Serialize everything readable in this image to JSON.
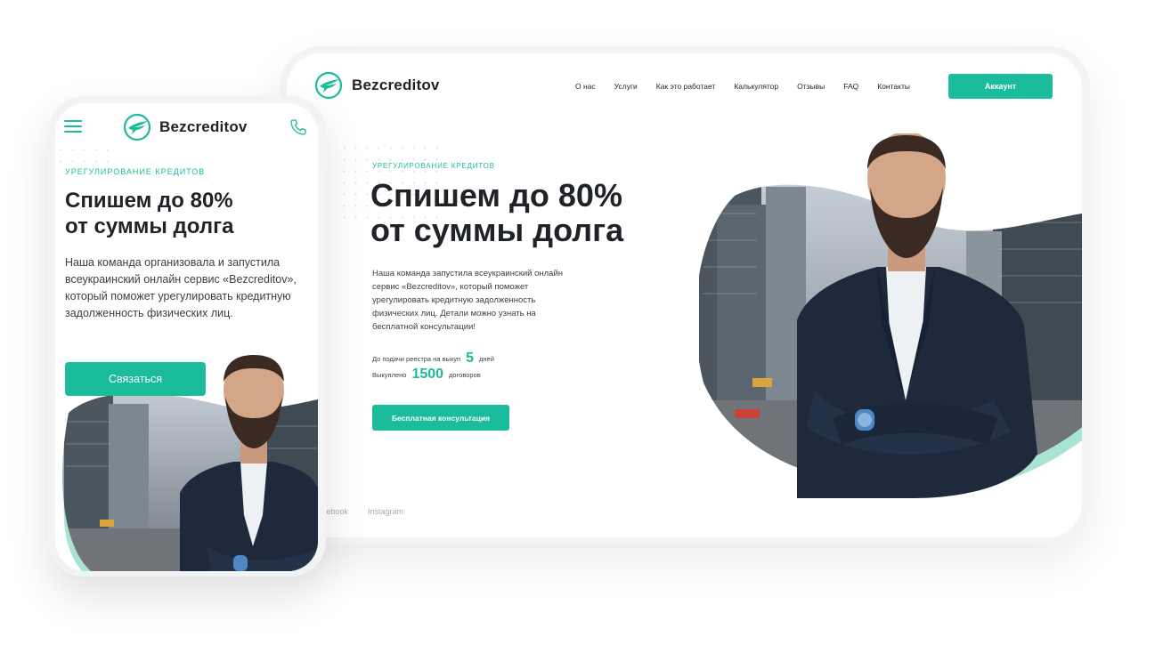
{
  "brand": {
    "name": "Bezcreditov",
    "accent_color": "#1bbc9b",
    "logo_icon": "wing-circle-logo-icon"
  },
  "desktop": {
    "nav": [
      "О нас",
      "Услуги",
      "Как это работает",
      "Калькулятор",
      "Отзывы",
      "FAQ",
      "Контакты"
    ],
    "account_label": "Аккаунт",
    "eyebrow": "УРЕГУЛИРОВАНИЕ КРЕДИТОВ",
    "headline_line1": "Спишем до 80%",
    "headline_line2": "от суммы долга",
    "description": "Наша команда запустила всеукраинский онлайн сервис «Bezcreditov», который поможет урегулировать кредитную задолженность физических лиц. Детали можно узнать на бесплатной консультации!",
    "stats": [
      {
        "prefix": "До подачи реестра на выкуп",
        "value": "5",
        "suffix": "дней"
      },
      {
        "prefix": "Выкуплено",
        "value": "1500",
        "suffix": "договоров"
      }
    ],
    "cta_label": "Бесплатная консультация",
    "social": [
      "cebook",
      "Instagram"
    ]
  },
  "mobile": {
    "menu_icon": "hamburger-menu-icon",
    "phone_icon": "phone-icon",
    "eyebrow": "УРЕГУЛИРОВАНИЕ КРЕДИТОВ",
    "headline_line1": "Спишем до 80%",
    "headline_line2": "от суммы долга",
    "description": "Наша команда организовала и запустила всеукраинский онлайн сервис «Bezcreditov», который поможет урегулировать кредитную задолженность физических лиц.",
    "cta_label": "Связаться"
  }
}
